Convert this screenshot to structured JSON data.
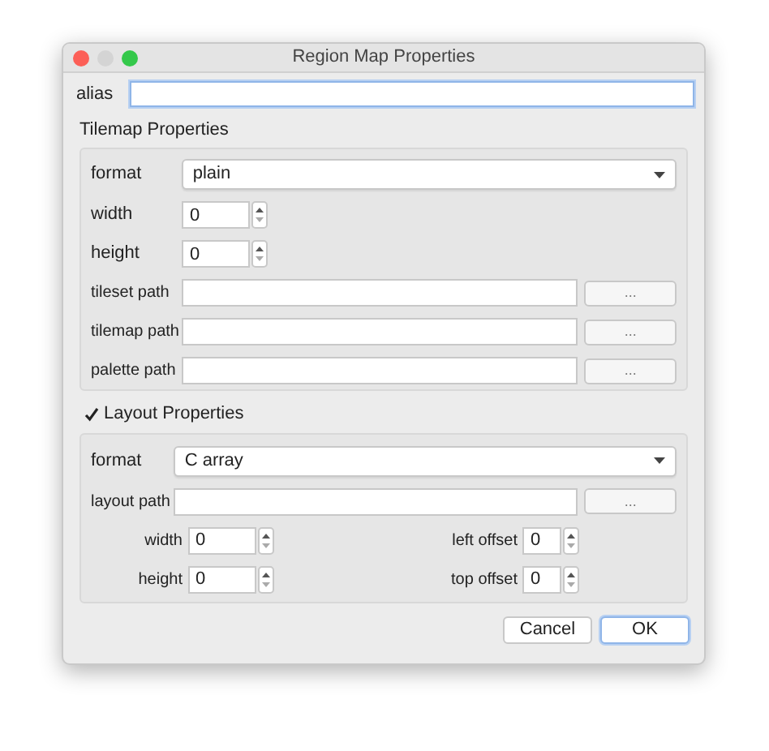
{
  "window": {
    "title": "Region Map Properties"
  },
  "alias": {
    "label": "alias",
    "focused": true
  },
  "tilemap": {
    "title": "Tilemap Properties",
    "format": {
      "label": "format",
      "value": "plain"
    },
    "spins": [
      {
        "label": "width",
        "value": "0"
      },
      {
        "label": "height",
        "value": "0"
      }
    ],
    "paths": [
      {
        "label": "tileset path",
        "button": "..."
      },
      {
        "label": "tilemap path",
        "button": "..."
      },
      {
        "label": "palette path",
        "button": "..."
      }
    ]
  },
  "layout": {
    "title": "Layout Properties",
    "checked": true,
    "format": {
      "label": "format",
      "value": "C array"
    },
    "path": {
      "label": "layout path",
      "button": "..."
    },
    "spins": [
      {
        "label": "width",
        "value": "0"
      },
      {
        "label": "left offset",
        "value": "0"
      },
      {
        "label": "height",
        "value": "0"
      },
      {
        "label": "top offset",
        "value": "0"
      }
    ]
  },
  "buttons": [
    {
      "label": "Cancel",
      "default": false
    },
    {
      "label": "OK",
      "default": true
    }
  ]
}
